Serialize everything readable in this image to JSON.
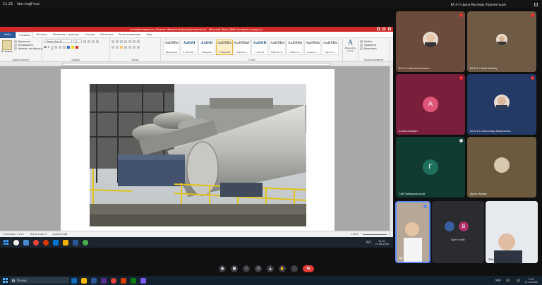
{
  "meet": {
    "time": "11:21",
    "meeting_code": "tbn-mqjf-vce",
    "presenter_label": "ЕА.З-1ч Дина Мусілова (Презентація)"
  },
  "word": {
    "window_title": "аттерміновування (Режим обмеженої функціональності) - Microsoft Word (Збій активації продукту)",
    "tabs": [
      "Файл",
      "Главная",
      "Вставка",
      "Разметка страницы",
      "Ссылки",
      "Рассылки",
      "Рецензирование",
      "Вид"
    ],
    "clipboard": {
      "paste_label": "Вставить",
      "cut": "Вырезать",
      "copy": "Копировать",
      "format_painter": "Формат по образцу",
      "group_label": "Буфер обмена"
    },
    "font": {
      "name": "Times New R...",
      "size": "5",
      "group_label": "Шрифт"
    },
    "paragraph_group_label": "Абзац",
    "styles": [
      {
        "preview": "АаБбВв",
        "name": "Выделение",
        "heading": false
      },
      {
        "preview": "АаБбI",
        "name": "¶ Заголов...",
        "heading": true
      },
      {
        "preview": "АаБбI",
        "name": "Название",
        "heading": true
      },
      {
        "preview": "АаБбВв",
        "name": "¶ Обычный",
        "heading": false
      },
      {
        "preview": "АаБбВвГ",
        "name": "Подзагол...",
        "heading": false
      },
      {
        "preview": "АаБбВ",
        "name": "Строгий",
        "heading": true
      },
      {
        "preview": "АаБбВв",
        "name": "¶ Без инте...",
        "heading": false
      },
      {
        "preview": "АаБбВв",
        "name": "Слабое в...",
        "heading": false
      },
      {
        "preview": "АаБбВв",
        "name": "Сильное ...",
        "heading": false
      },
      {
        "preview": "АаБбВв",
        "name": "Цитата 2",
        "heading": false
      }
    ],
    "change_styles": "Изменить стили",
    "styles_group_label": "Стили",
    "editing": {
      "find": "Найти",
      "replace": "Заменить",
      "select": "Выделить",
      "group_label": "Редактирование"
    },
    "status": {
      "page": "Страница: 2 из 5",
      "words": "Число слов: 0",
      "language": "украинский",
      "zoom": "100%"
    }
  },
  "remote_taskbar": {
    "time": "11:21",
    "date": "21.06.2020",
    "lang": "РУС"
  },
  "participants": [
    {
      "name": "ЕА.З-1ч Артем Кулагин",
      "type": "video"
    },
    {
      "name": "ЕА.З-1ч Danil Korotky",
      "type": "video"
    },
    {
      "name": "Аліна Самарін",
      "type": "letter",
      "letter": "А",
      "color": "#e0567a"
    },
    {
      "name": "ЕА.З-1ч Олександр Кириленко",
      "type": "video"
    },
    {
      "name": "ТАВ Табаорянський",
      "type": "letter",
      "letter": "Г",
      "color": "#1e6f5c"
    },
    {
      "name": "Дунас Бойко",
      "type": "video"
    }
  ],
  "bottom_tiles": {
    "self_name": "Ви",
    "others_label": "Ще 9 осіб",
    "others_letter": "В",
    "presenter_small": "Зібрані Карпан"
  },
  "colors": {
    "word_title_red": "#cf2a27",
    "file_tab_blue": "#2b5797",
    "end_call_red": "#e53935"
  },
  "local_taskbar": {
    "search_placeholder": "Пошук",
    "time": "11:27",
    "date": "21.06.2020",
    "lang": "УКР"
  }
}
